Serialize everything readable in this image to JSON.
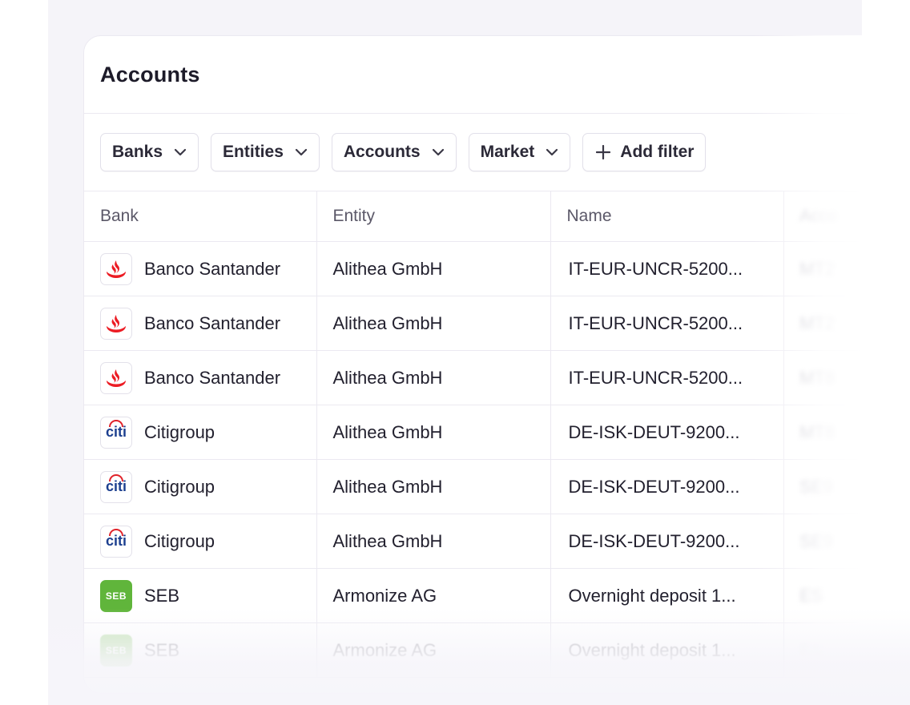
{
  "card": {
    "title": "Accounts"
  },
  "filters": [
    {
      "label": "Banks",
      "icon": "chevron-down-icon"
    },
    {
      "label": "Entities",
      "icon": "chevron-down-icon"
    },
    {
      "label": "Accounts",
      "icon": "chevron-down-icon"
    },
    {
      "label": "Market",
      "icon": "chevron-down-icon"
    }
  ],
  "add_filter": {
    "label": "Add filter",
    "icon": "plus-icon"
  },
  "table": {
    "columns": [
      "Bank",
      "Entity",
      "Name",
      "Acco"
    ],
    "rows": [
      {
        "bank": "Banco Santander",
        "logo": "santander-logo",
        "entity": "Alithea GmbH",
        "name": "IT-EUR-UNCR-5200...",
        "account": "MT2"
      },
      {
        "bank": "Banco Santander",
        "logo": "santander-logo",
        "entity": "Alithea GmbH",
        "name": "IT-EUR-UNCR-5200...",
        "account": "MT2"
      },
      {
        "bank": "Banco Santander",
        "logo": "santander-logo",
        "entity": "Alithea GmbH",
        "name": "IT-EUR-UNCR-5200...",
        "account": "MT8"
      },
      {
        "bank": "Citigroup",
        "logo": "citi-logo",
        "entity": "Alithea GmbH",
        "name": "DE-ISK-DEUT-9200...",
        "account": "MT8"
      },
      {
        "bank": "Citigroup",
        "logo": "citi-logo",
        "entity": "Alithea GmbH",
        "name": "DE-ISK-DEUT-9200...",
        "account": "SE9"
      },
      {
        "bank": "Citigroup",
        "logo": "citi-logo",
        "entity": "Alithea GmbH",
        "name": "DE-ISK-DEUT-9200...",
        "account": "SE9"
      },
      {
        "bank": "SEB",
        "logo": "seb-logo",
        "entity": "Armonize AG",
        "name": "Overnight deposit 1...",
        "account": "ES"
      },
      {
        "bank": "SEB",
        "logo": "seb-logo",
        "entity": "Armonize AG",
        "name": "Overnight deposit 1...",
        "account": "ES"
      }
    ]
  },
  "logo_text": {
    "citi": "citi",
    "seb": "SEB"
  },
  "colors": {
    "santander": "#ec1c24",
    "citi_blue": "#1c3f8f",
    "citi_red": "#e0222a",
    "seb": "#60b53b"
  }
}
